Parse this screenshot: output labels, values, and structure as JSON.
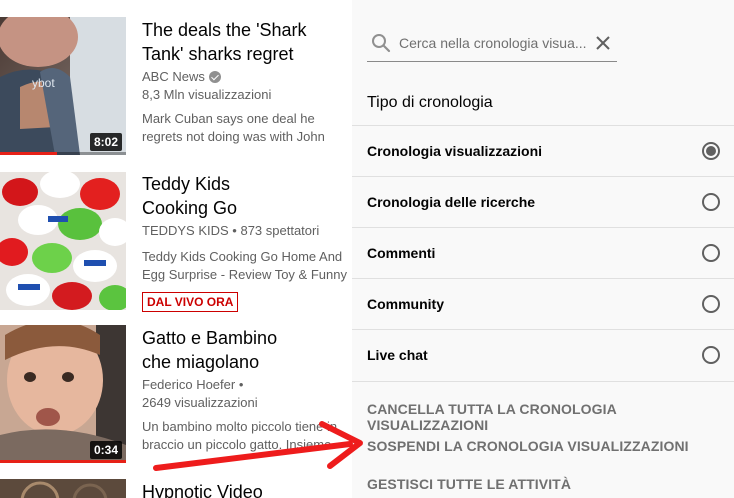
{
  "videos": [
    {
      "title": "The deals the 'Shark Tank' sharks regret",
      "channel": "ABC News",
      "verified": true,
      "stats": "8,3 Mln visualizzazioni",
      "description": "Mark Cuban says one deal he regrets not doing was with John",
      "duration": "8:02",
      "progress": 0.45
    },
    {
      "title": "Teddy Kids Cooking Go",
      "channel": "TEDDYS KIDS • 873 spettatori",
      "description": "Teddy Kids Cooking Go Home And Egg Surprise - Review Toy & Funny",
      "live_badge": "DAL VIVO ORA"
    },
    {
      "title": "Gatto e Bambino che miagolano",
      "channel": "Federico Hoefer •",
      "stats": "2649 visualizzazioni",
      "description": "Un bambino molto piccolo tiene in braccio un piccolo gatto. Insieme",
      "duration": "0:34",
      "progress": 1.0
    },
    {
      "title": "Hypnotic Video"
    }
  ],
  "panel": {
    "search_placeholder": "Cerca nella cronologia visua...",
    "heading": "Tipo di cronologia",
    "options": [
      {
        "label": "Cronologia visualizzazioni",
        "checked": true
      },
      {
        "label": "Cronologia delle ricerche",
        "checked": false
      },
      {
        "label": "Commenti",
        "checked": false
      },
      {
        "label": "Community",
        "checked": false
      },
      {
        "label": "Live chat",
        "checked": false
      }
    ],
    "actions": [
      "CANCELLA TUTTA LA CRONOLOGIA VISUALIZZAZIONI",
      "SOSPENDI LA CRONOLOGIA VISUALIZZAZIONI",
      "GESTISCI TUTTE LE ATTIVITÀ"
    ]
  },
  "colors": {
    "accent_red": "#e62117",
    "annotation_arrow": "#ee1c1c",
    "panel_bg": "#f9f9f9"
  },
  "icons": {
    "search": "search-icon",
    "clear": "close-icon",
    "verified": "verified-check-icon"
  }
}
